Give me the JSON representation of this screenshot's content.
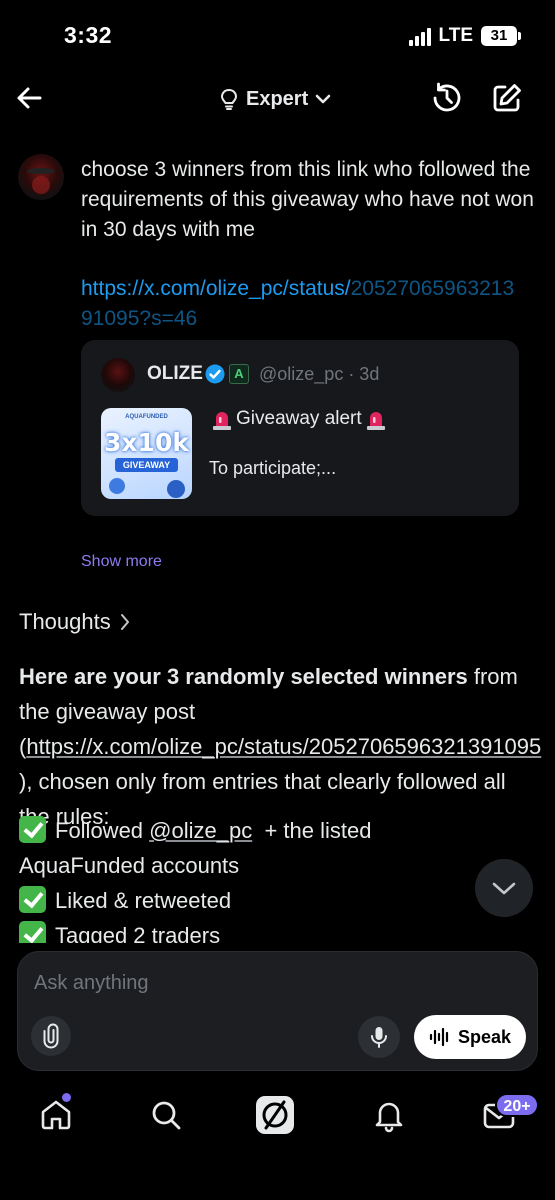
{
  "status_bar": {
    "time": "3:32",
    "network": "LTE",
    "battery": "31"
  },
  "header": {
    "mode_label": "Expert"
  },
  "user_message": {
    "text": "choose 3 winners from this link who followed the requirements of this giveaway who have not won in 30 days with me",
    "link_part1": "https://x.com/olize_pc/status/",
    "link_part2": "2052706596321391095?s=46"
  },
  "quoted_post": {
    "author": "OLIZE",
    "affiliate_badge": "A",
    "handle_time": "@olize_pc · 3d",
    "title": "Giveaway alert",
    "snippet": "To participate;...",
    "thumbnail": {
      "top_text": "AQUAFUNDED",
      "big_text": "3x10k",
      "small_text": "GIVEAWAY"
    }
  },
  "show_more": "Show more",
  "thoughts_label": "Thoughts",
  "reply": {
    "lead_bold": "Here are your 3 randomly selected winners",
    "lead_rest1": " from the giveaway post (",
    "link": "https://x.com/olize_pc/status/2052706596321391095",
    "lead_rest2": " ), chosen only from entries that clearly followed all the rules:",
    "items": [
      {
        "pre": "Followed ",
        "mention": "@olize_pc",
        "post": "  + the listed AquaFunded accounts"
      },
      {
        "pre": "Liked & retweeted",
        "mention": "",
        "post": ""
      },
      {
        "pre": "Tagged 2 traders",
        "mention": "",
        "post": ""
      }
    ]
  },
  "ask_bar": {
    "placeholder": "Ask anything",
    "speak_label": "Speak"
  },
  "tab_bar": {
    "messages_badge": "20+"
  },
  "colors": {
    "accent": "#1d9bf0",
    "badge": "#7b6cf0",
    "check": "#44b548",
    "card": "#16181c"
  }
}
